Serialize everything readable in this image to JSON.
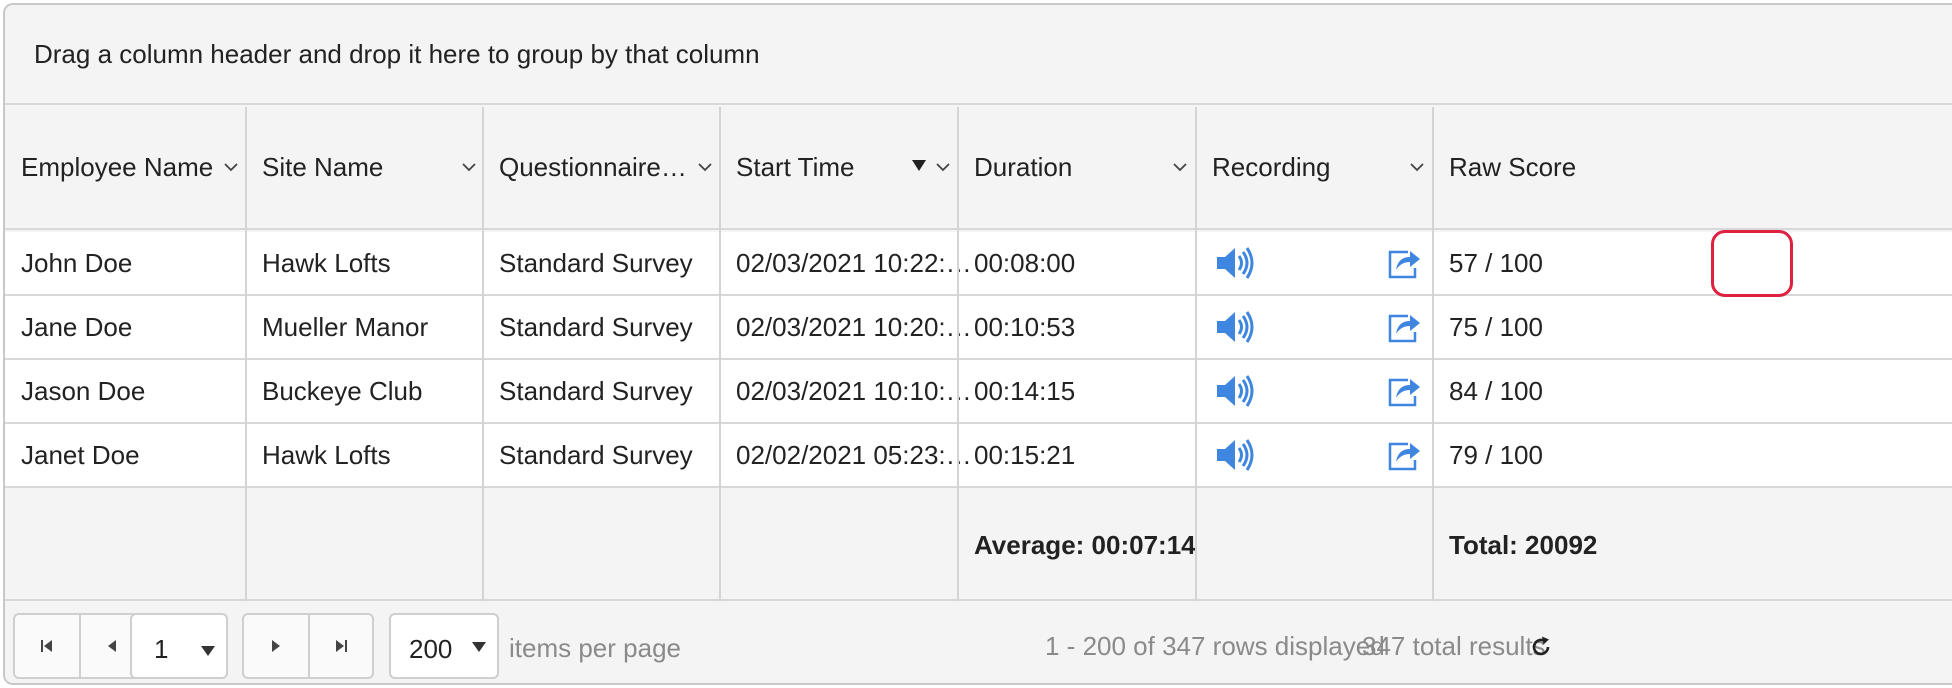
{
  "group_panel": {
    "hint": "Drag a column header and drop it here to group by that column"
  },
  "columns": [
    {
      "label": "Employee Name"
    },
    {
      "label": "Site Name"
    },
    {
      "label": "Questionnaire…"
    },
    {
      "label": "Start Time",
      "sorted": "descending"
    },
    {
      "label": "Duration"
    },
    {
      "label": "Recording"
    },
    {
      "label": "Raw Score"
    }
  ],
  "rows": [
    {
      "employee": "John Doe",
      "site": "Hawk Lofts",
      "questionnaire": "Standard Survey",
      "start": "02/03/2021 10:22:…",
      "duration": "00:08:00",
      "score": "57 / 100"
    },
    {
      "employee": "Jane Doe",
      "site": "Mueller Manor",
      "questionnaire": "Standard Survey",
      "start": "02/03/2021 10:20:…",
      "duration": "00:10:53",
      "score": "75 / 100"
    },
    {
      "employee": "Jason Doe",
      "site": "Buckeye Club",
      "questionnaire": "Standard Survey",
      "start": "02/03/2021 10:10:…",
      "duration": "00:14:15",
      "score": "84 / 100"
    },
    {
      "employee": "Janet Doe",
      "site": "Hawk Lofts",
      "questionnaire": "Standard Survey",
      "start": "02/02/2021 05:23:…",
      "duration": "00:15:21",
      "score": "79 / 100"
    }
  ],
  "footer": {
    "duration_agg": "Average: 00:07:14",
    "score_agg": "Total: 20092"
  },
  "pager": {
    "page": "1",
    "page_size": "200",
    "items_per_page": "items per page",
    "rows_info": "1 - 200 of 347 rows displayed",
    "total_info": "347 total results"
  },
  "icons": {
    "recording": "speaker-icon",
    "share": "share-icon",
    "refresh": "refresh-icon"
  },
  "colors": {
    "icon_blue": "#3f86e0",
    "highlight": "#e0203f"
  }
}
